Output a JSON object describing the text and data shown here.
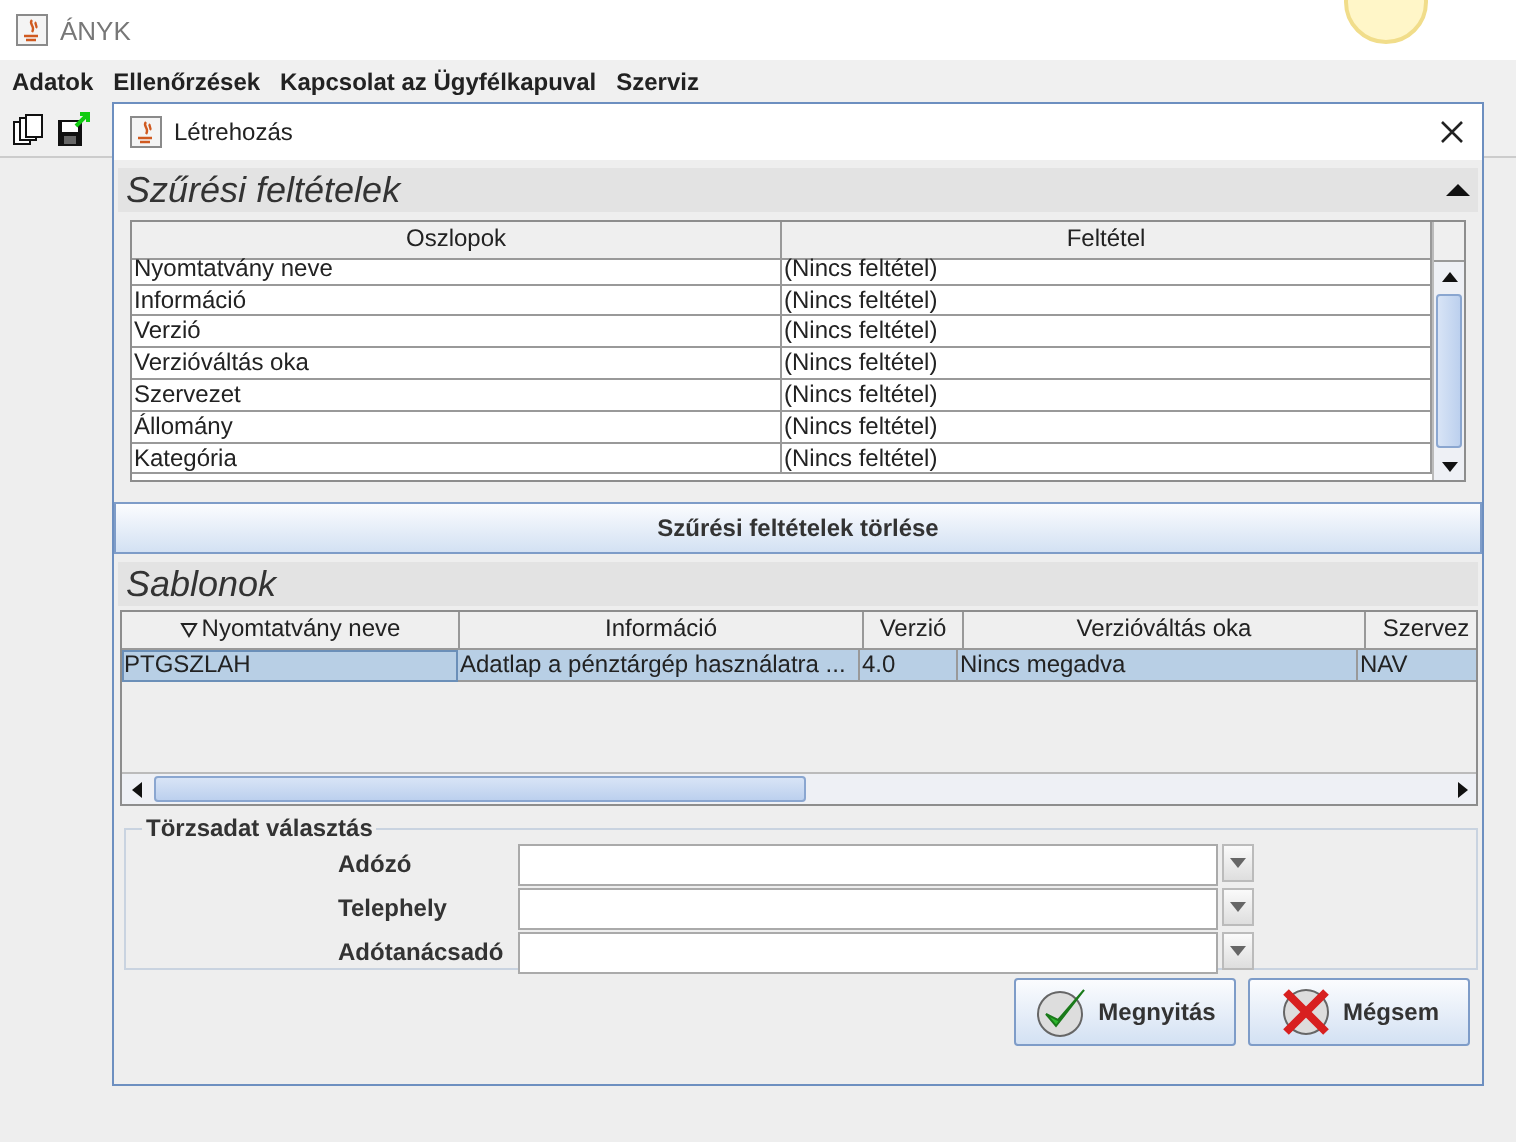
{
  "app": {
    "title": "ÁNYK"
  },
  "menu": [
    {
      "label": "Adatok"
    },
    {
      "label": "Ellenőrzések"
    },
    {
      "label": "Kapcsolat az Ügyfélkapuval"
    },
    {
      "label": "Szerviz"
    }
  ],
  "dialog": {
    "title": "Létrehozás",
    "filter_section": {
      "title": "Szűrési feltételek",
      "expanded": true,
      "columns": [
        "Oszlopok",
        "Feltétel"
      ],
      "rows": [
        {
          "column": "Nyomtatvány neve",
          "condition": "(Nincs feltétel)"
        },
        {
          "column": "Információ",
          "condition": "(Nincs feltétel)"
        },
        {
          "column": "Verzió",
          "condition": "(Nincs feltétel)"
        },
        {
          "column": "Verzióváltás oka",
          "condition": "(Nincs feltétel)"
        },
        {
          "column": "Szervezet",
          "condition": "(Nincs feltétel)"
        },
        {
          "column": "Állomány",
          "condition": "(Nincs feltétel)"
        },
        {
          "column": "Kategória",
          "condition": "(Nincs feltétel)"
        }
      ]
    },
    "clear_button": "Szűrési feltételek törlése",
    "templates": {
      "title": "Sablonok",
      "columns": [
        {
          "label": "Nyomtatvány neve",
          "sorted": true
        },
        {
          "label": "Információ",
          "sorted": false
        },
        {
          "label": "Verzió",
          "sorted": false
        },
        {
          "label": "Verzióváltás oka",
          "sorted": false
        },
        {
          "label": "Szervez",
          "sorted": false
        }
      ],
      "rows": [
        {
          "cells": [
            "PTGSZLAH",
            "Adatlap a pénztárgép használatra ...",
            "4.0",
            "Nincs megadva",
            "NAV"
          ],
          "selected": true
        }
      ]
    },
    "master_data": {
      "title": "Törzsadat választás",
      "fields": [
        {
          "label": "Adózó"
        },
        {
          "label": "Telephely"
        },
        {
          "label": "Adótanácsadó"
        }
      ]
    },
    "buttons": [
      {
        "label": "Megnyitás",
        "kind": "ok"
      },
      {
        "label": "Mégsem",
        "kind": "cancel"
      }
    ]
  }
}
